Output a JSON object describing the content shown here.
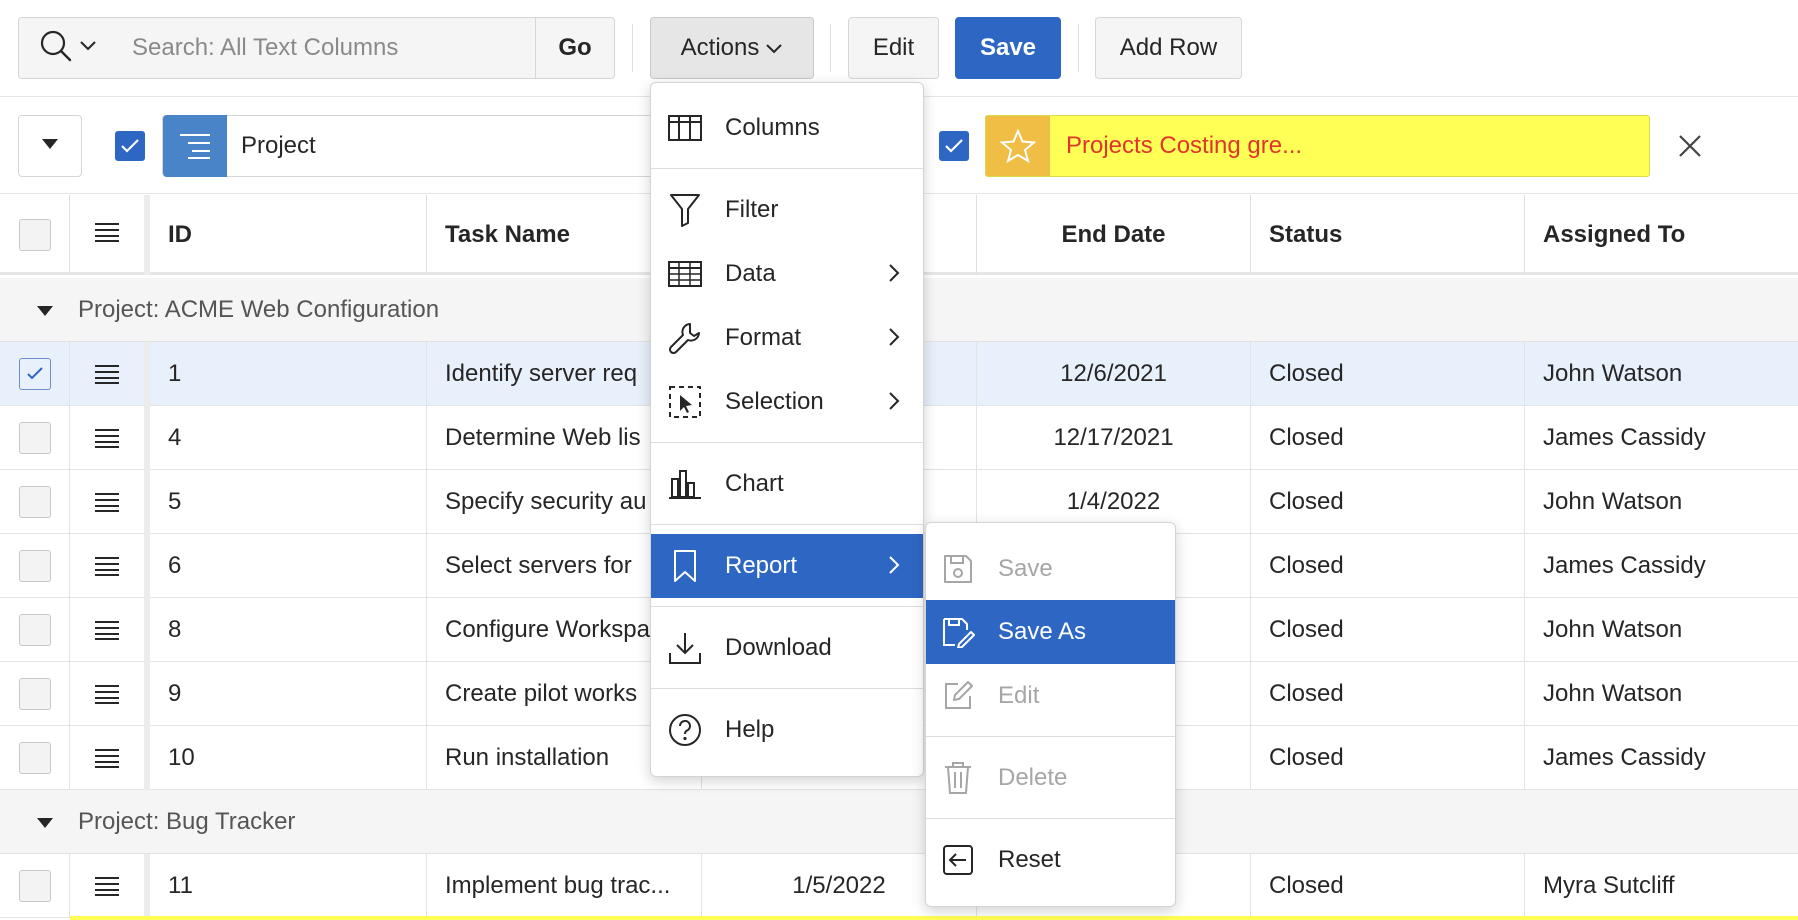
{
  "toolbar": {
    "search_placeholder": "Search: All Text Columns",
    "go_label": "Go",
    "actions_label": "Actions",
    "edit_label": "Edit",
    "save_label": "Save",
    "add_row_label": "Add Row"
  },
  "filters": {
    "group_by_label": "Project",
    "highlight_label": "Projects Costing gre...",
    "highlight_color": "#ffff55",
    "highlight_text_color": "#e0352b"
  },
  "columns": {
    "id": "ID",
    "task_name": "Task Name",
    "end_date": "End Date",
    "status": "Status",
    "assigned_to": "Assigned To"
  },
  "groups": [
    {
      "label": "Project: ACME Web Configuration",
      "rows": [
        {
          "id": "1",
          "task": "Identify server req",
          "start": "",
          "end": "12/6/2021",
          "status": "Closed",
          "assigned": "John Watson",
          "selected": true
        },
        {
          "id": "4",
          "task": "Determine Web lis",
          "start": "",
          "end": "12/17/2021",
          "status": "Closed",
          "assigned": "James Cassidy",
          "selected": false
        },
        {
          "id": "5",
          "task": "Specify security au",
          "start": "",
          "end": "1/4/2022",
          "status": "Closed",
          "assigned": "John Watson",
          "selected": false
        },
        {
          "id": "6",
          "task": "Select servers for",
          "start": "",
          "end": "",
          "status": "Closed",
          "assigned": "James Cassidy",
          "selected": false
        },
        {
          "id": "8",
          "task": "Configure Workspa",
          "start": "",
          "end": "",
          "status": "Closed",
          "assigned": "John Watson",
          "selected": false
        },
        {
          "id": "9",
          "task": "Create pilot works",
          "start": "",
          "end": "",
          "status": "Closed",
          "assigned": "John Watson",
          "selected": false
        },
        {
          "id": "10",
          "task": "Run installation",
          "start": "",
          "end": "",
          "status": "Closed",
          "assigned": "James Cassidy",
          "selected": false
        }
      ]
    },
    {
      "label": "Project: Bug Tracker",
      "rows": [
        {
          "id": "11",
          "task": "Implement bug trac...",
          "start": "1/5/2022",
          "end": "",
          "status": "Closed",
          "assigned": "Myra Sutcliff",
          "selected": false
        }
      ]
    }
  ],
  "actions_menu": {
    "items": [
      "Columns",
      "Filter",
      "Data",
      "Format",
      "Selection",
      "Chart",
      "Report",
      "Download",
      "Help"
    ],
    "active": "Report"
  },
  "report_submenu": {
    "items": [
      "Save",
      "Save As",
      "Edit",
      "Delete",
      "Reset"
    ],
    "active": "Save As"
  },
  "colors": {
    "primary": "#2e67c3",
    "selected_row": "#e8f0fb",
    "group_bg": "#f5f5f5"
  },
  "icons": {
    "search": "magnifier-icon",
    "group_by": "group-by-icon",
    "highlight": "star-icon",
    "close": "close-icon"
  }
}
